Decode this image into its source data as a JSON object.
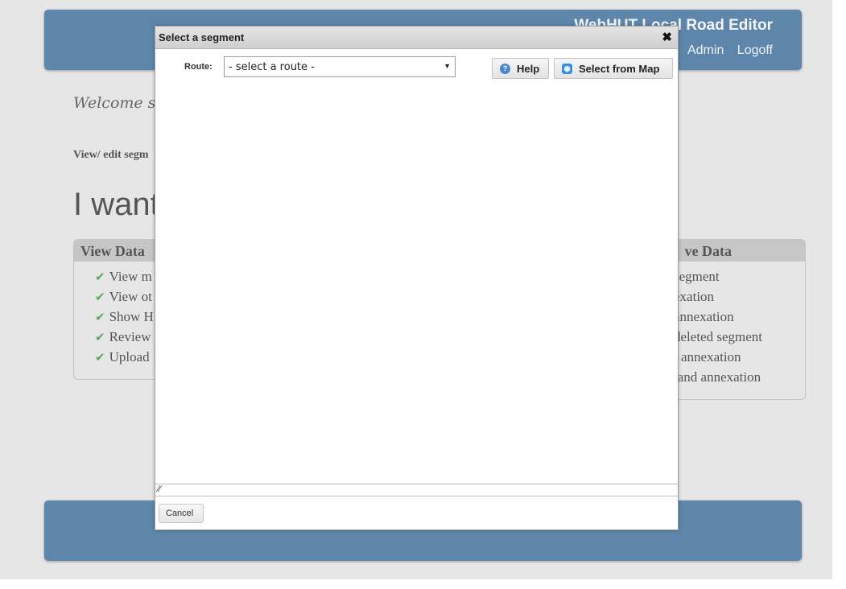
{
  "header": {
    "title": "WebHUT Local Road Editor",
    "nav": [
      "Admin",
      "Logoff"
    ]
  },
  "welcome_text": "Welcome ste",
  "edit_line": "View/ edit segm",
  "page_heading": "I want",
  "panels": {
    "view": {
      "title": "View Data",
      "items": [
        "View m",
        "View ot",
        "Show H",
        "Review",
        "Upload"
      ]
    },
    "edit": {
      "title": "ve Data",
      "items": [
        "segment",
        "exation",
        "annexation",
        "deleted segment",
        "l annexation",
        "land annexation"
      ]
    }
  },
  "dialog": {
    "title": "Select a segment",
    "close_icon": "close-icon",
    "route_label": "Route:",
    "route_select_value": "- select a route -",
    "help_label": "Help",
    "select_from_map_label": "Select from Map",
    "cancel_label": "Cancel"
  },
  "colors": {
    "banner": "#5e86ab",
    "page_background": "#e6e6e6",
    "check": "#5aa75a"
  }
}
